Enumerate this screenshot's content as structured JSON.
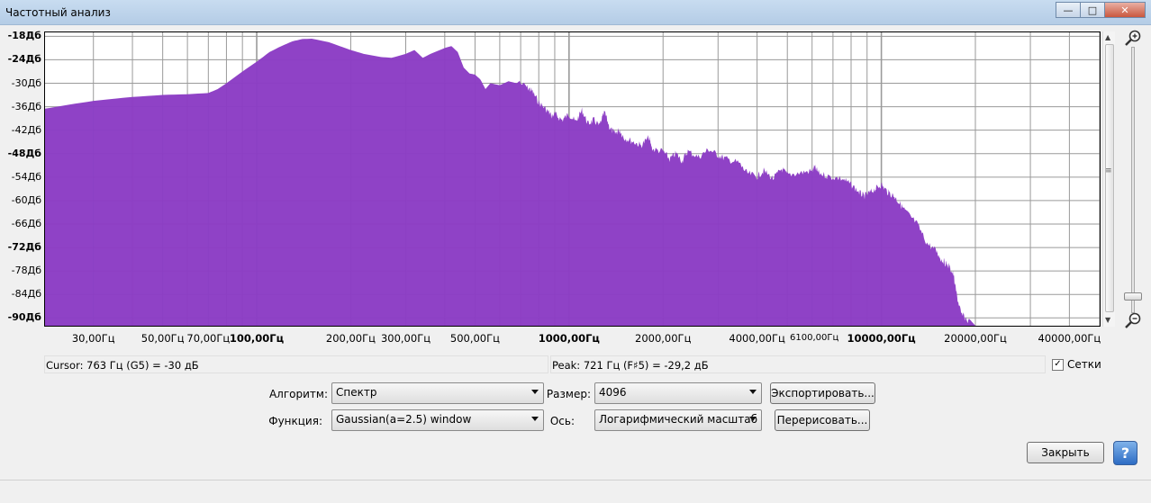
{
  "window": {
    "title": "Частотный анализ",
    "controls": {
      "minimize": "—",
      "maximize": "□",
      "close": "✕"
    }
  },
  "plot": {
    "fill_color": "#8b3cc4",
    "grid_color": "#9a9a9a",
    "y_ticks": [
      {
        "label": "-18Дб",
        "db": -18,
        "bold": true
      },
      {
        "label": "-24Дб",
        "db": -24,
        "bold": true
      },
      {
        "label": "-30Дб",
        "db": -30,
        "bold": false
      },
      {
        "label": "-36Дб",
        "db": -36,
        "bold": false
      },
      {
        "label": "-42Дб",
        "db": -42,
        "bold": false
      },
      {
        "label": "-48Дб",
        "db": -48,
        "bold": true
      },
      {
        "label": "-54Дб",
        "db": -54,
        "bold": false
      },
      {
        "label": "-60Дб",
        "db": -60,
        "bold": false
      },
      {
        "label": "-66Дб",
        "db": -66,
        "bold": false
      },
      {
        "label": "-72Дб",
        "db": -72,
        "bold": true
      },
      {
        "label": "-78Дб",
        "db": -78,
        "bold": false
      },
      {
        "label": "-84Дб",
        "db": -84,
        "bold": false
      },
      {
        "label": "-90Дб",
        "db": -90,
        "bold": true
      }
    ],
    "x_ticks": [
      {
        "label": "30,00Гц",
        "hz": 30,
        "bold": false
      },
      {
        "label": "50,00Гц",
        "hz": 50,
        "bold": false
      },
      {
        "label": "70,00Гц",
        "hz": 70,
        "bold": false
      },
      {
        "label": "100,00Гц",
        "hz": 100,
        "bold": true
      },
      {
        "label": "200,00Гц",
        "hz": 200,
        "bold": false
      },
      {
        "label": "300,00Гц",
        "hz": 300,
        "bold": false
      },
      {
        "label": "500,00Гц",
        "hz": 500,
        "bold": false
      },
      {
        "label": "1000,00Гц",
        "hz": 1000,
        "bold": true
      },
      {
        "label": "2000,00Гц",
        "hz": 2000,
        "bold": false
      },
      {
        "label": "4000,00Гц",
        "hz": 4000,
        "bold": false
      },
      {
        "label": "6100,00Гц",
        "hz": 6100,
        "bold": false,
        "small": true
      },
      {
        "label": "10000,00Гц",
        "hz": 10000,
        "bold": true
      },
      {
        "label": "20000,00Гц",
        "hz": 20000,
        "bold": false
      },
      {
        "label": "40000,00Гц",
        "hz": 40000,
        "bold": false
      }
    ],
    "x_range_hz": [
      21,
      50000
    ],
    "y_range_db": [
      -92,
      -17
    ],
    "spectrum": [
      [
        21,
        -36.5
      ],
      [
        25,
        -35.5
      ],
      [
        30,
        -34.5
      ],
      [
        40,
        -33.5
      ],
      [
        50,
        -33
      ],
      [
        60,
        -32.8
      ],
      [
        70,
        -32.5
      ],
      [
        75,
        -31.5
      ],
      [
        80,
        -30
      ],
      [
        90,
        -27
      ],
      [
        100,
        -24.5
      ],
      [
        110,
        -22
      ],
      [
        120,
        -20.5
      ],
      [
        130,
        -19.3
      ],
      [
        140,
        -18.7
      ],
      [
        150,
        -18.6
      ],
      [
        170,
        -19.5
      ],
      [
        200,
        -21.5
      ],
      [
        220,
        -22.5
      ],
      [
        250,
        -23.3
      ],
      [
        270,
        -23.5
      ],
      [
        300,
        -22.5
      ],
      [
        320,
        -21.5
      ],
      [
        340,
        -23.5
      ],
      [
        360,
        -22.5
      ],
      [
        400,
        -21
      ],
      [
        420,
        -20.5
      ],
      [
        440,
        -22
      ],
      [
        460,
        -26
      ],
      [
        480,
        -27.5
      ],
      [
        500,
        -27.8
      ],
      [
        520,
        -29
      ],
      [
        540,
        -31.5
      ],
      [
        560,
        -30
      ],
      [
        600,
        -30.5
      ],
      [
        640,
        -29.5
      ],
      [
        680,
        -30
      ],
      [
        700,
        -29.2
      ],
      [
        730,
        -30
      ],
      [
        760,
        -31
      ],
      [
        800,
        -34
      ],
      [
        850,
        -36
      ],
      [
        880,
        -37.5
      ],
      [
        900,
        -37
      ],
      [
        950,
        -38.5
      ],
      [
        1000,
        -37
      ],
      [
        1050,
        -39
      ],
      [
        1100,
        -36
      ],
      [
        1150,
        -39.5
      ],
      [
        1200,
        -38.5
      ],
      [
        1250,
        -40
      ],
      [
        1300,
        -36.5
      ],
      [
        1350,
        -40.5
      ],
      [
        1400,
        -42
      ],
      [
        1450,
        -41
      ],
      [
        1500,
        -43
      ],
      [
        1600,
        -44
      ],
      [
        1700,
        -45
      ],
      [
        1800,
        -43
      ],
      [
        1850,
        -46
      ],
      [
        2000,
        -46.5
      ],
      [
        2100,
        -48.5
      ],
      [
        2200,
        -47
      ],
      [
        2300,
        -49
      ],
      [
        2400,
        -46.5
      ],
      [
        2600,
        -48
      ],
      [
        2800,
        -46
      ],
      [
        3000,
        -47.5
      ],
      [
        3200,
        -48.5
      ],
      [
        3500,
        -49.5
      ],
      [
        3700,
        -52
      ],
      [
        4000,
        -53
      ],
      [
        4200,
        -51.5
      ],
      [
        4500,
        -53.5
      ],
      [
        4800,
        -51
      ],
      [
        5000,
        -52.5
      ],
      [
        5500,
        -52
      ],
      [
        6000,
        -51.5
      ],
      [
        6100,
        -50.5
      ],
      [
        6300,
        -52
      ],
      [
        6800,
        -53
      ],
      [
        7500,
        -53.5
      ],
      [
        8000,
        -55
      ],
      [
        8500,
        -57
      ],
      [
        8800,
        -58
      ],
      [
        9200,
        -57
      ],
      [
        9600,
        -56
      ],
      [
        10000,
        -55
      ],
      [
        10500,
        -57
      ],
      [
        11000,
        -58
      ],
      [
        11500,
        -60
      ],
      [
        12000,
        -62
      ],
      [
        13000,
        -65
      ],
      [
        14000,
        -70
      ],
      [
        15000,
        -72
      ],
      [
        15500,
        -74
      ],
      [
        16000,
        -75
      ],
      [
        16500,
        -76
      ],
      [
        17000,
        -78
      ],
      [
        17500,
        -84
      ],
      [
        18000,
        -88
      ],
      [
        19000,
        -90
      ],
      [
        20000,
        -92
      ],
      [
        50000,
        -92
      ]
    ]
  },
  "zoom": {
    "zoom_in_icon": "zoom-in-icon",
    "zoom_out_icon": "zoom-out-icon"
  },
  "cursor_info": "Cursor:  763 Гц (G5) = -30 дБ",
  "peak_info": "Peak:  721 Гц (F♯5) = -29,2 дБ",
  "grid_checkbox": {
    "label": "Сетки",
    "checked": true
  },
  "controls": {
    "algorithm_label": "Алгоритм:",
    "algorithm_value": "Спектр",
    "size_label": "Размер:",
    "size_value": "4096",
    "export_button": "Экспортировать...",
    "function_label": "Функция:",
    "function_value": "Gaussian(a=2.5) window",
    "axis_label": "Ось:",
    "axis_value": "Логарифмический масштаб",
    "redraw_button": "Перерисовать...",
    "close_button": "Закрыть",
    "help_button": "?"
  }
}
